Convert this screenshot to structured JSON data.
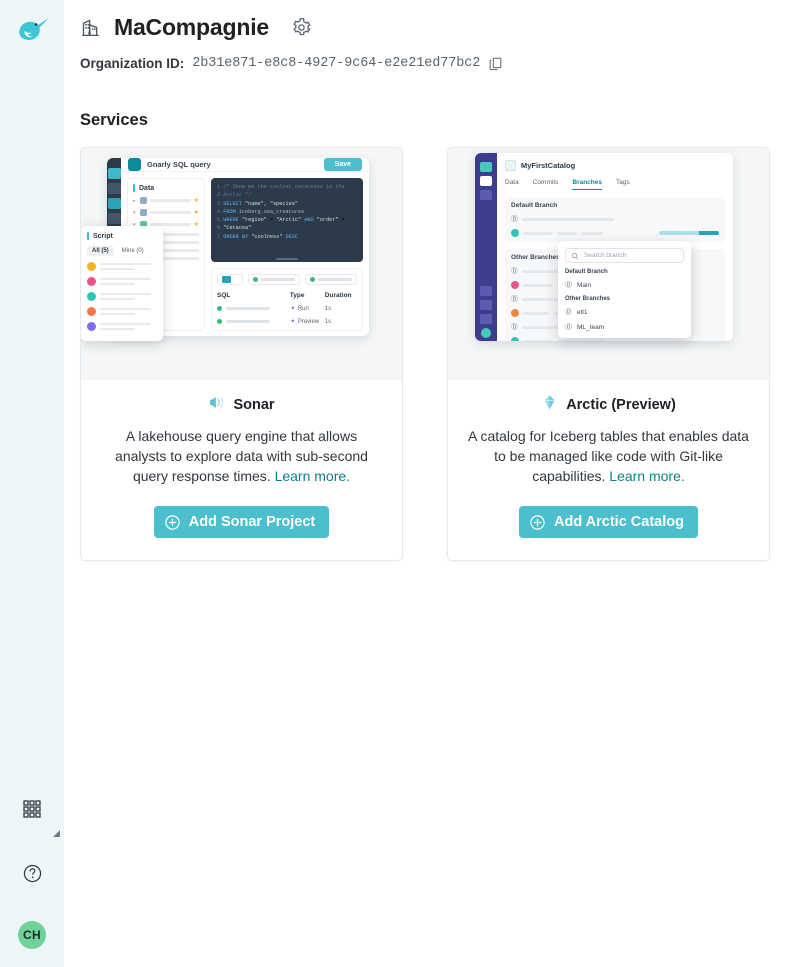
{
  "rail": {
    "logo_icon": "dremio-narwhal-logo",
    "apps_icon": "apps-grid-icon",
    "help_icon": "help-circle-icon",
    "avatar_initials": "CH"
  },
  "header": {
    "org_icon": "building-icon",
    "title": "MaCompagnie",
    "settings_icon": "gear-icon",
    "org_id_label": "Organization ID:",
    "org_id_value": "2b31e871-e8c8-4927-9c64-e2e21ed77bc2",
    "copy_icon": "copy-icon"
  },
  "services": {
    "section_title": "Services",
    "cards": [
      {
        "icon": "sonar-sound-wave-icon",
        "title": "Sonar",
        "description": "A lakehouse query engine that allows analysts to explore data with sub-second query response times.",
        "learn_more": "Learn more.",
        "button_label": "Add Sonar Project",
        "button_icon": "plus-circle-icon"
      },
      {
        "icon": "arctic-iceberg-icon",
        "title": "Arctic (Preview)",
        "description": "A catalog for Iceberg tables that enables data to be managed like code with Git-like capabilities.",
        "learn_more": "Learn more.",
        "button_label": "Add Arctic Catalog",
        "button_icon": "plus-circle-icon"
      }
    ]
  },
  "sonar_mock": {
    "window_title": "Gnarly SQL query",
    "save_label": "Save",
    "data_panel_label": "Data",
    "code_lines": [
      {
        "n": "1",
        "text": "/* Show me the coolest cetaceans in the"
      },
      {
        "n": "2",
        "text": "Arctic */"
      },
      {
        "n": "3",
        "text": "SELECT \"name\", \"species\""
      },
      {
        "n": "4",
        "text": "FROM iceberg.sea_creatures"
      },
      {
        "n": "5",
        "text": "WHERE \"region\" = \"Arctic\" AND \"order\" ="
      },
      {
        "n": "6",
        "text": "\"Cetacea\""
      },
      {
        "n": "7",
        "text": "ORDER BY \"coolness\" DESC"
      }
    ],
    "results_headers": [
      "SQL",
      "Type",
      "Duration"
    ],
    "results_rows": [
      {
        "type": "Run",
        "duration": "1s"
      },
      {
        "type": "Preview",
        "duration": "1s"
      }
    ],
    "script_popover": {
      "title": "Script",
      "tabs": [
        "All (5)",
        "Mine (0)"
      ]
    }
  },
  "arctic_mock": {
    "catalog_name": "MyFirstCatalog",
    "tabs": [
      "Data",
      "Commits",
      "Branches",
      "Tags"
    ],
    "active_tab": "Branches",
    "default_branch_label": "Default Branch",
    "other_branches_label": "Other Branches",
    "popover": {
      "search_placeholder": "Search branch",
      "search_icon": "search-icon",
      "default_branch_label": "Default Branch",
      "other_branches_label": "Other Branches",
      "branches": [
        "Main",
        "etl1",
        "ML_team"
      ]
    }
  },
  "colors": {
    "accent_teal": "#4cbfcd",
    "link_teal": "#127e8a",
    "rail_bg": "#edf7f9",
    "avatar_green": "#6ed29a",
    "card_thumb_bg": "#f4f6f7"
  }
}
